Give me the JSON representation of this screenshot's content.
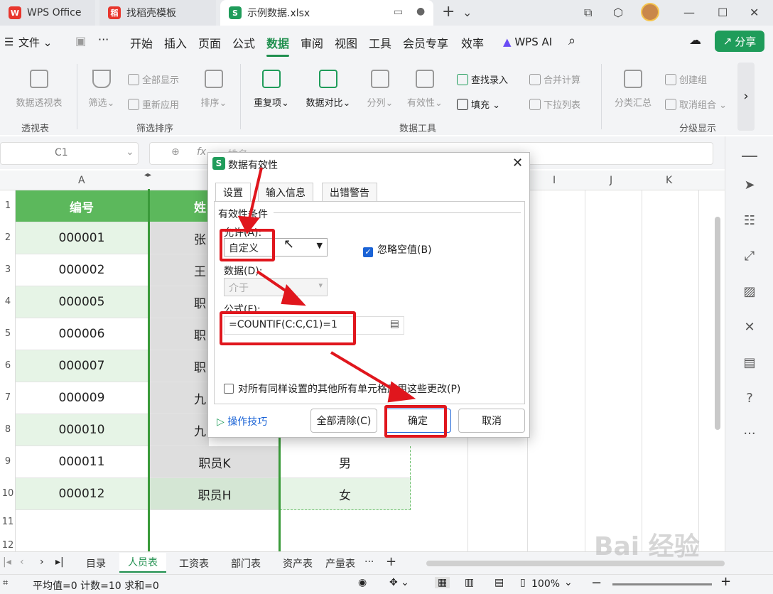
{
  "tabs": [
    {
      "label": "WPS Office"
    },
    {
      "label": "找稻壳模板"
    },
    {
      "label": "示例数据.xlsx"
    }
  ],
  "menu": {
    "file": "文件",
    "items": [
      "开始",
      "插入",
      "页面",
      "公式",
      "数据",
      "审阅",
      "视图",
      "工具",
      "会员专享",
      "效率"
    ],
    "active": "数据",
    "wps_ai": "WPS AI",
    "share": "分享"
  },
  "ribbon": {
    "pivot": "数据透视表",
    "filter": "筛选",
    "show_all": "全部显示",
    "reapply": "重新应用",
    "sort": "排序",
    "duplicates": "重复项",
    "compare": "数据对比",
    "split": "分列",
    "validity": "有效性",
    "lookup": "查找录入",
    "fill": "填充",
    "merge_calc": "合并计算",
    "dropdown": "下拉列表",
    "subtotal": "分类汇总",
    "create_group": "创建组",
    "ungroup": "取消组合",
    "group_pivot": "透视表",
    "group_filter": "筛选排序",
    "group_tools": "数据工具",
    "group_outline": "分级显示"
  },
  "formula_bar": {
    "namebox": "C1",
    "fx": "fx",
    "content": "姓名"
  },
  "columns": [
    "A",
    "I",
    "J",
    "K"
  ],
  "rows": [
    {
      "num": "1",
      "a": "编号",
      "b": "姓",
      "c": ""
    },
    {
      "num": "2",
      "a": "000001",
      "b": "张",
      "c": ""
    },
    {
      "num": "3",
      "a": "000002",
      "b": "王",
      "c": ""
    },
    {
      "num": "4",
      "a": "000005",
      "b": "职",
      "c": ""
    },
    {
      "num": "5",
      "a": "000006",
      "b": "职",
      "c": ""
    },
    {
      "num": "6",
      "a": "000007",
      "b": "职",
      "c": ""
    },
    {
      "num": "7",
      "a": "000009",
      "b": "九",
      "c": ""
    },
    {
      "num": "8",
      "a": "000010",
      "b": "九",
      "c": ""
    },
    {
      "num": "9",
      "a": "000011",
      "b": "职员K",
      "c": "男"
    },
    {
      "num": "10",
      "a": "000012",
      "b": "职员H",
      "c": "女"
    },
    {
      "num": "11",
      "a": "",
      "b": "",
      "c": ""
    },
    {
      "num": "12",
      "a": "",
      "b": "",
      "c": ""
    }
  ],
  "sheet_tabs": [
    "目录",
    "人员表",
    "工资表",
    "部门表",
    "资产表",
    "产量表"
  ],
  "active_sheet": "人员表",
  "status": {
    "summary": "平均值=0  计数=10  求和=0",
    "zoom": "100%"
  },
  "dialog": {
    "title": "数据有效性",
    "tabs": [
      "设置",
      "输入信息",
      "出错警告"
    ],
    "section": "有效性条件",
    "allow_label": "允许(A):",
    "allow_value": "自定义",
    "ignore_blank": "忽略空值(B)",
    "data_label": "数据(D):",
    "data_value": "介于",
    "formula_label": "公式(F):",
    "formula_value": "=COUNTIF(C:C,C1)=1",
    "apply_all": "对所有同样设置的其他所有单元格应用这些更改(P)",
    "tips": "操作技巧",
    "clear_all": "全部清除(C)",
    "ok": "确定",
    "cancel": "取消"
  },
  "watermark": "Bai 经验"
}
